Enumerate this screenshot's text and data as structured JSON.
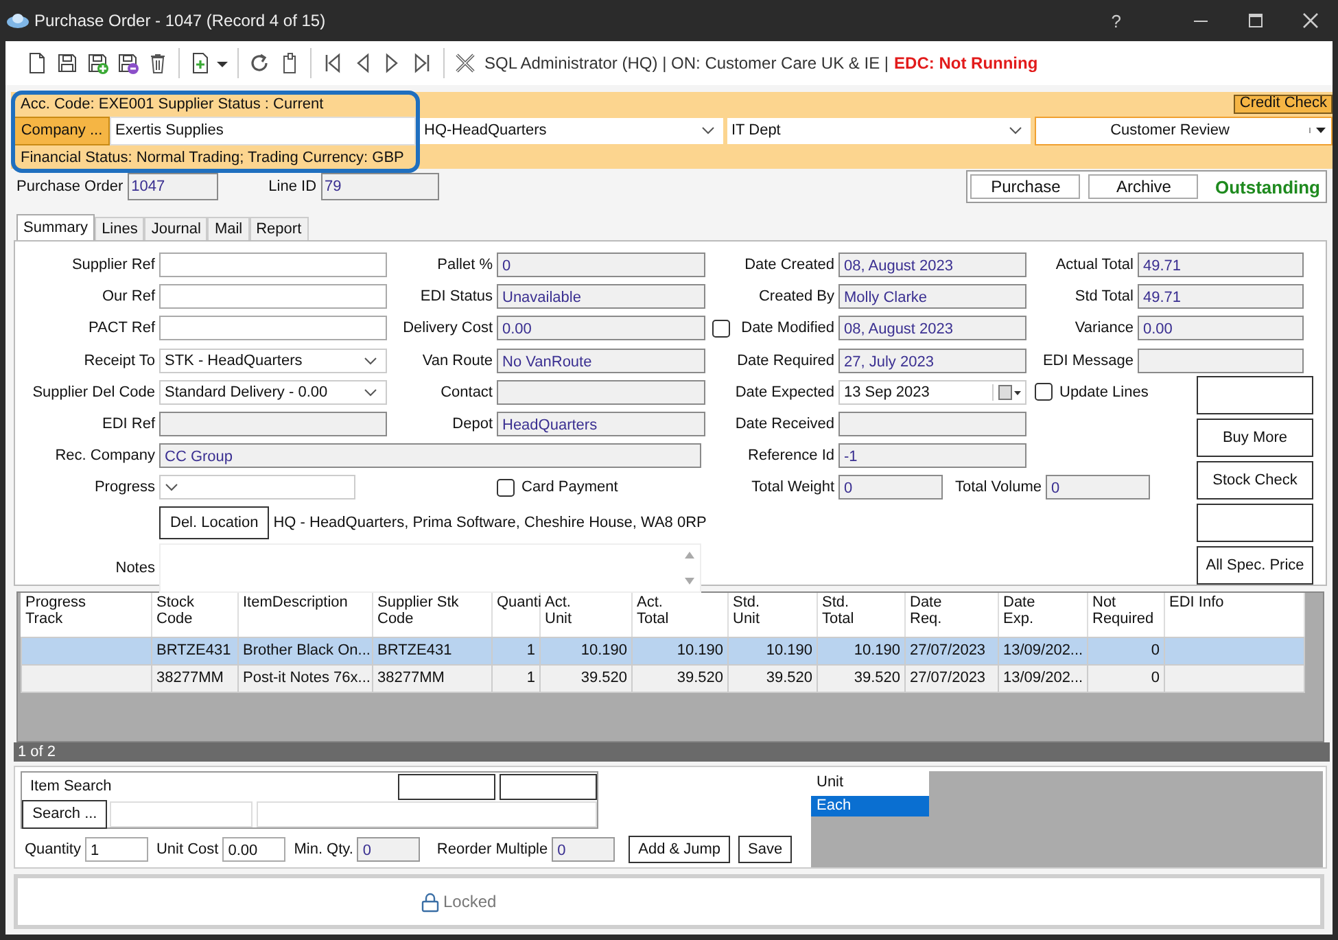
{
  "window": {
    "title": "Purchase Order - 1047  (Record 4 of 15)",
    "help": "?"
  },
  "toolbar": {
    "status": "SQL Administrator (HQ) | ON: Customer  Care UK & IE |",
    "edc": "EDC: Not Running"
  },
  "account_band": {
    "summary": "Acc. Code: EXE001  Supplier Status : Current",
    "credit_check": "Credit Check",
    "company_button": "Company ...",
    "company": "Exertis Supplies",
    "selects": [
      "HQ-HeadQuarters",
      "IT Dept"
    ],
    "review": "Customer Review",
    "financial": "Financial Status: Normal Trading; Trading Currency: GBP"
  },
  "record": {
    "po_label": "Purchase Order",
    "po": "1047",
    "line_label": "Line ID",
    "line_id": "79",
    "actions": [
      {
        "kind": "button",
        "label": "Purchase"
      },
      {
        "kind": "button",
        "label": "Archive"
      },
      {
        "kind": "status",
        "label": "Outstanding"
      }
    ]
  },
  "tabs": [
    {
      "label": "Summary",
      "selected": true
    },
    {
      "label": "Lines",
      "selected": false
    },
    {
      "label": "Journal",
      "selected": false
    },
    {
      "label": "Mail",
      "selected": false
    },
    {
      "label": "Report",
      "selected": false
    }
  ],
  "summary": {
    "left_rows": [
      [
        {
          "kind": "field",
          "label": "Supplier Ref",
          "readonly": false
        },
        {
          "kind": "field",
          "label": "Pallet %",
          "value": "0",
          "readonly": true
        }
      ],
      [
        {
          "kind": "field",
          "label": "Our Ref",
          "readonly": false
        },
        {
          "kind": "field",
          "label": "EDI Status",
          "value": "Unavailable",
          "readonly": true
        }
      ],
      [
        {
          "kind": "field",
          "label": "PACT Ref",
          "readonly": false
        },
        {
          "kind": "field",
          "label": "Delivery Cost",
          "value": "0.00",
          "readonly": true
        },
        {
          "kind": "check",
          "checked": false
        }
      ],
      [
        {
          "kind": "select",
          "label": "Receipt To",
          "value": "STK - HeadQuarters"
        },
        {
          "kind": "field",
          "label": "Van Route",
          "value": "No VanRoute",
          "readonly": true
        }
      ],
      [
        {
          "kind": "select",
          "label": "Supplier Del Code",
          "value": "Standard Delivery - 0.00"
        },
        {
          "kind": "field",
          "label": "Contact",
          "readonly": true
        }
      ],
      [
        {
          "kind": "field",
          "label": "EDI Ref",
          "readonly": true
        },
        {
          "kind": "field",
          "label": "Depot",
          "value": "HeadQuarters",
          "readonly": true
        }
      ],
      [
        {
          "kind": "wide",
          "label": "Rec. Company",
          "value": "CC Group",
          "readonly": true
        }
      ],
      [
        {
          "kind": "select",
          "label": "Progress"
        },
        {
          "kind": "check",
          "label": "Card Payment",
          "checked": false
        }
      ],
      [
        {
          "kind": "button",
          "label": "Del. Location"
        },
        {
          "kind": "text",
          "text": "HQ - HeadQuarters, Prima Software, Cheshire House, WA8 0RP"
        }
      ],
      [
        {
          "kind": "notes",
          "label": "Notes"
        }
      ]
    ],
    "right_rows": [
      [
        {
          "kind": "field",
          "label": "Date Created",
          "value": "08, August 2023",
          "readonly": true
        },
        {
          "kind": "field",
          "label": "Actual Total",
          "value": "49.71",
          "readonly": true
        }
      ],
      [
        {
          "kind": "field",
          "label": "Created By",
          "value": "Molly Clarke",
          "readonly": true
        },
        {
          "kind": "field",
          "label": "Std Total",
          "value": "49.71",
          "readonly": true
        }
      ],
      [
        {
          "kind": "field",
          "label": "Date Modified",
          "value": "08, August 2023",
          "readonly": true
        },
        {
          "kind": "field",
          "label": "Variance",
          "value": "0.00",
          "readonly": true
        }
      ],
      [
        {
          "kind": "field",
          "label": "Date Required",
          "value": "27, July 2023",
          "readonly": true
        },
        {
          "kind": "field",
          "label": "EDI Message",
          "readonly": true
        }
      ],
      [
        {
          "kind": "date",
          "label": "Date Expected",
          "value": "13 Sep 2023"
        },
        {
          "kind": "check",
          "label": "Update Lines",
          "checked": false
        }
      ],
      [
        {
          "kind": "field",
          "label": "Date Received",
          "readonly": true
        }
      ],
      [
        {
          "kind": "field",
          "label": "Reference Id",
          "value": "-1",
          "readonly": true
        }
      ],
      [
        {
          "kind": "field",
          "label": "Total Weight",
          "value": "0",
          "readonly": true
        },
        {
          "kind": "field",
          "label": "Total Volume",
          "value": "0",
          "readonly": true
        }
      ]
    ],
    "side_buttons": [
      {
        "kind": "blank"
      },
      {
        "kind": "button",
        "label": "Buy More"
      },
      {
        "kind": "button",
        "label": "Stock Check"
      },
      {
        "kind": "blank"
      },
      {
        "kind": "button",
        "label": "All Spec. Price"
      }
    ]
  },
  "lines_table": {
    "columns": [
      "Progress\nTrack",
      "Stock\nCode",
      "ItemDescription",
      "Supplier Stk\nCode",
      "Quanti",
      "Act.\nUnit",
      "Act.\nTotal",
      "Std.\nUnit",
      "Std.\nTotal",
      "Date\nReq.",
      "Date\nExp.",
      "Not\nRequired",
      "EDI Info"
    ],
    "rows": [
      {
        "selected": true,
        "cells": [
          "",
          "BRTZE431",
          "Brother Black On...",
          "BRTZE431",
          "1",
          "10.190",
          "10.190",
          "10.190",
          "10.190",
          "27/07/2023",
          "13/09/202...",
          "0",
          ""
        ]
      },
      {
        "selected": false,
        "cells": [
          "",
          "38277MM",
          "Post-it Notes 76x...",
          "38277MM",
          "1",
          "39.520",
          "39.520",
          "39.520",
          "39.520",
          "27/07/2023",
          "13/09/202...",
          "0",
          ""
        ]
      }
    ],
    "pager": "1 of 2"
  },
  "item_entry": {
    "search_label": "Item Search",
    "search_button": "Search ...",
    "fields": [
      {
        "label": "Quantity",
        "value": "1",
        "readonly": false
      },
      {
        "label": "Unit Cost",
        "value": "0.00",
        "readonly": false
      },
      {
        "label": "Min. Qty.",
        "value": "0",
        "readonly": true
      },
      {
        "label": "Reorder Multiple",
        "value": "0",
        "readonly": true
      }
    ],
    "buttons": [
      "Add & Jump",
      "Save"
    ],
    "unit_list": {
      "header": "Unit",
      "items": [
        {
          "label": "Each",
          "selected": true
        }
      ]
    }
  },
  "lock": {
    "label": "Locked"
  }
}
